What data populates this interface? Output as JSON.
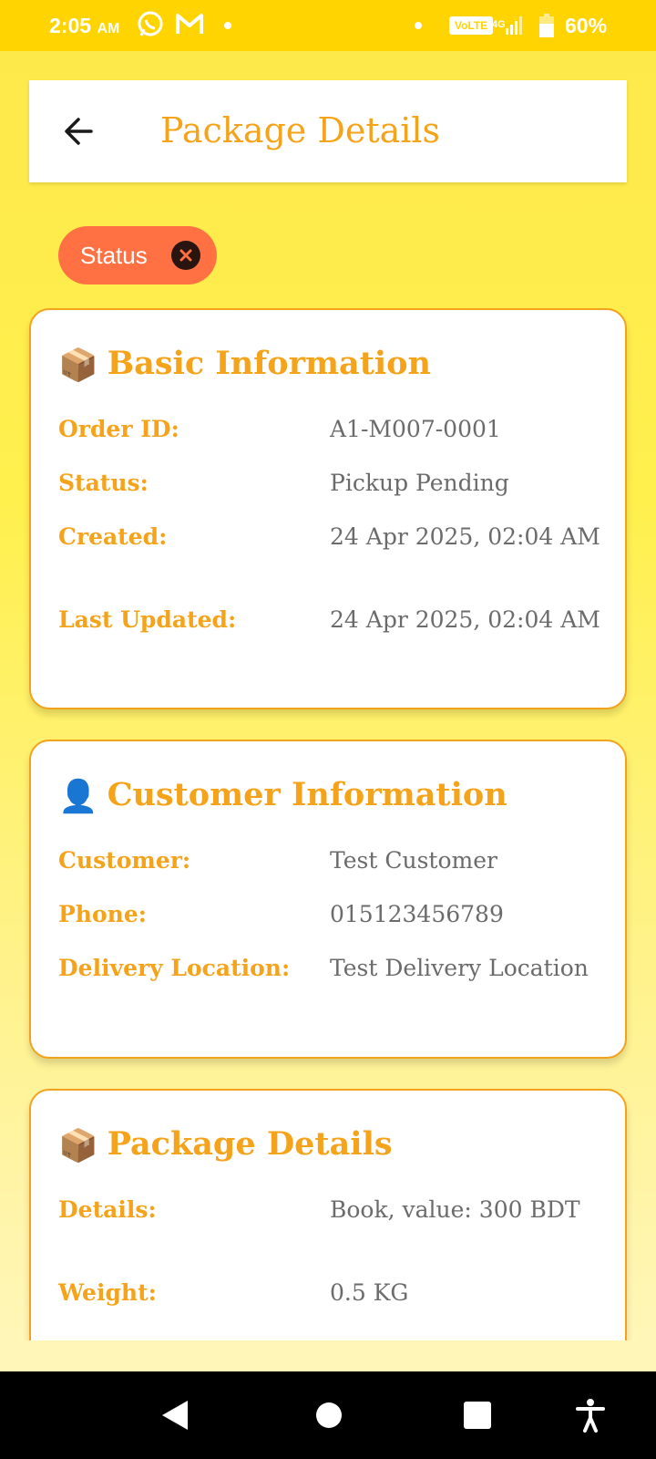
{
  "status_bar": {
    "time": "2:05",
    "ampm": "AM",
    "volte": "VoLTE",
    "network": "4G",
    "battery": "60%",
    "icons": [
      "whatsapp-icon",
      "gmail-icon",
      "signal-icon",
      "battery-icon"
    ]
  },
  "header": {
    "title": "Package Details",
    "back_icon": "arrow-left-icon"
  },
  "filter_chip": {
    "label": "Status",
    "close_icon": "close-circle-icon",
    "color": "#ff7043"
  },
  "cards": [
    {
      "emoji": "📦",
      "title": "Basic Information",
      "rows": [
        {
          "label": "Order ID:",
          "value": "A1-M007-0001"
        },
        {
          "label": "Status:",
          "value": "Pickup Pending"
        },
        {
          "label": "Created:",
          "value": "24 Apr 2025, 02:04 AM"
        },
        {
          "label": "Last Updated:",
          "value": "24 Apr 2025, 02:04 AM"
        }
      ]
    },
    {
      "emoji": "👤",
      "title": "Customer Information",
      "rows": [
        {
          "label": "Customer:",
          "value": "Test Customer"
        },
        {
          "label": "Phone:",
          "value": "015123456789"
        },
        {
          "label": "Delivery Location:",
          "value": "Test Delivery Location"
        }
      ]
    },
    {
      "emoji": "📦",
      "title": "Package Details",
      "rows": [
        {
          "label": "Details:",
          "value": "Book, value: 300 BDT"
        },
        {
          "label": "Weight:",
          "value": "0.5 KG"
        }
      ]
    }
  ],
  "nav_bar": [
    "back-triangle-icon",
    "home-circle-icon",
    "recents-square-icon",
    "accessibility-icon"
  ],
  "colors": {
    "accent": "#f5a31a",
    "status_bar": "#ffd400",
    "background": "#fff04e",
    "value_text": "#6b6b6b"
  }
}
